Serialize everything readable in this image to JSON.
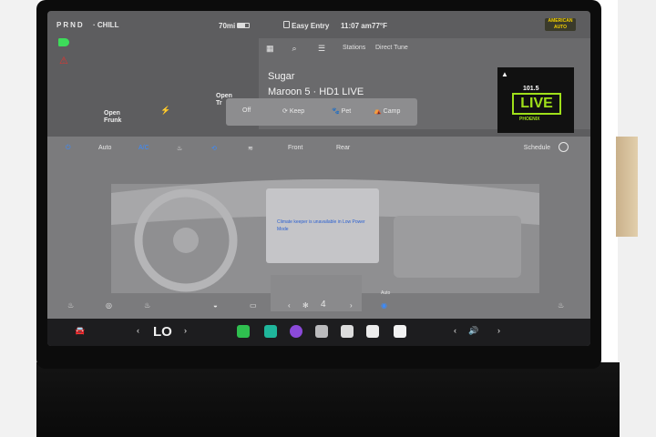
{
  "status_bar": {
    "gear": "PRND",
    "separator": "·",
    "drive_mode": "CHILL",
    "range": "70mi",
    "profile": "Easy Entry",
    "time": "11:07 am",
    "outside_temp": "77°F"
  },
  "media": {
    "tabs": [
      "Stations",
      "Direct Tune"
    ],
    "station_name": "Sugar",
    "artist_line": "Maroon 5 · HD1 LIVE",
    "album_art": {
      "frequency": "101.5",
      "brand": "LIVE",
      "city": "PHOENIX",
      "accent": "#9fe01a"
    }
  },
  "trunk": {
    "front_label": "Open\nFrunk",
    "rear_label": "Open\nTr"
  },
  "climate_modes": {
    "items": [
      "Off",
      "Keep",
      "Pet",
      "Camp"
    ]
  },
  "climate": {
    "auto": "Auto",
    "ac": "A/C",
    "front": "Front",
    "rear": "Rear",
    "schedule": "Schedule",
    "notice": "Climate keeper is unavailable in Low Power Mode",
    "fan_auto": "Auto",
    "fan_speed": "4"
  },
  "dock": {
    "temperature": "LO"
  },
  "colors": {
    "accent_blue": "#3a8bff",
    "headlight_green": "#3ddc5a",
    "seatbelt_red": "#e2332f"
  }
}
